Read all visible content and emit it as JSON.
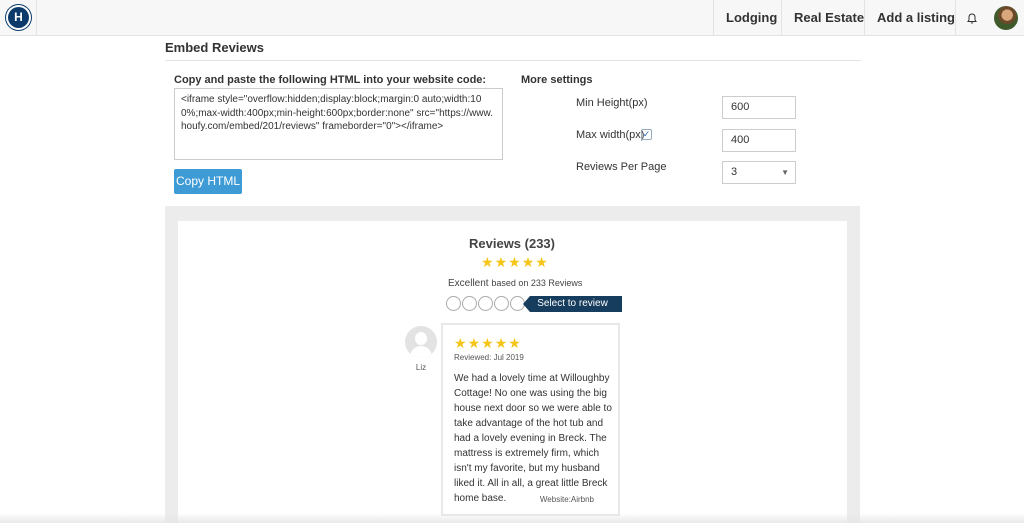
{
  "nav": {
    "logo_letter": "H",
    "items": [
      "Lodging",
      "Real Estate",
      "Add a listing"
    ]
  },
  "page": {
    "title": "Embed Reviews"
  },
  "embed": {
    "label": "Copy and paste the following HTML into your website code:",
    "code": "<iframe style=\"overflow:hidden;display:block;margin:0 auto;width:100%;max-width:400px;min-height:600px;border:none\" src=\"https://www.houfy.com/embed/201/reviews\" frameborder=\"0\"></iframe>",
    "copy_button": "Copy HTML"
  },
  "settings": {
    "title": "More settings",
    "min_height_label": "Min Height(px)",
    "min_height_value": "600",
    "max_width_label": "Max width(px)",
    "max_width_checked": true,
    "max_width_value": "400",
    "reviews_per_page_label": "Reviews Per Page",
    "reviews_per_page_value": "3"
  },
  "preview": {
    "title": "Reviews (233)",
    "rating_stars": 5,
    "excellent": "Excellent",
    "based_on": "based on 233 Reviews",
    "select_to_review": "Select to review",
    "review": {
      "reviewer": "Liz",
      "stars": 5,
      "date": "Reviewed: Jul 2019",
      "text": "We had a lovely time at Willoughby Cottage! No one was using the big house next door so we were able to take advantage of the hot tub and had a lovely evening in Breck. The mattress is extremely firm, which isn't my favorite, but my husband liked it. All in all, a great little Breck home base.",
      "source": "Website:Airbnb"
    }
  },
  "colors": {
    "accent_button": "#3f9bd6",
    "select_tab": "#173d5e",
    "star": "#f5c518"
  }
}
